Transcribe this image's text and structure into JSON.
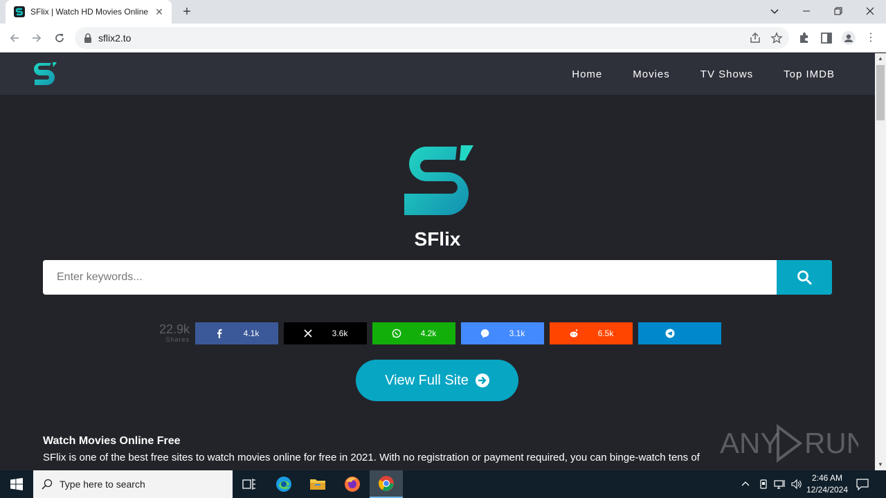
{
  "browser": {
    "tab_title": "SFlix | Watch HD Movies Online Free",
    "tab_close": "✕",
    "new_tab": "+",
    "url": "sflix2.to",
    "window_controls": {
      "dropdown": "⌄",
      "minimize": "—",
      "restore": "❐",
      "close": "✕"
    }
  },
  "site": {
    "nav": [
      "Home",
      "Movies",
      "TV Shows",
      "Top IMDB"
    ],
    "title": "SFlix",
    "search_placeholder": "Enter keywords...",
    "shares": {
      "total": "22.9k",
      "label": "Shares",
      "buttons": [
        {
          "network": "facebook",
          "count": "4.1k",
          "color": "#3b5998"
        },
        {
          "network": "x",
          "count": "3.6k",
          "color": "#000000"
        },
        {
          "network": "whatsapp",
          "count": "4.2k",
          "color": "#12af0a"
        },
        {
          "network": "messenger",
          "count": "3.1k",
          "color": "#448aff"
        },
        {
          "network": "reddit",
          "count": "6.5k",
          "color": "#ff4500"
        },
        {
          "network": "telegram",
          "count": "",
          "color": "#0088cc"
        }
      ]
    },
    "view_full_site": "View Full Site",
    "about_title": "Watch Movies Online Free",
    "about_text": "SFlix is one of the best free sites to watch movies online for free in 2021. With no registration or payment required, you can binge-watch tens of",
    "accent_color": "#07a6c3"
  },
  "watermark": "ANY.RUN",
  "taskbar": {
    "search_placeholder": "Type here to search",
    "time": "2:46 AM",
    "date": "12/24/2024"
  }
}
